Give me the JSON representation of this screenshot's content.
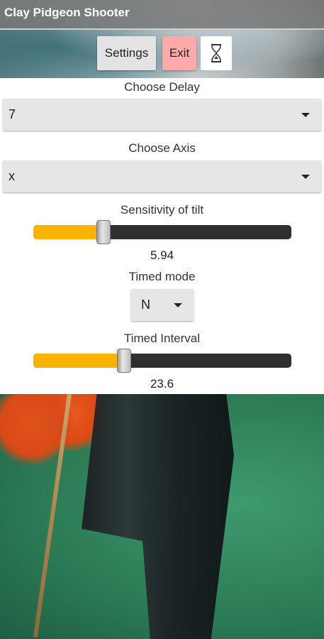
{
  "app": {
    "title": "Clay Pidgeon Shooter"
  },
  "toolbar": {
    "settings_label": "Settings",
    "exit_label": "Exit",
    "timer_icon": "hourglass-icon",
    "timer_glyph": "⌛",
    "colors": {
      "exit_bg": "#ffaaaa",
      "settings_bg": "#e3e3e3"
    }
  },
  "form": {
    "delay": {
      "label": "Choose Delay",
      "value": "7"
    },
    "axis": {
      "label": "Choose Axis",
      "value": "x"
    },
    "sensitivity": {
      "label": "Sensitivity of tilt",
      "value": "5.94",
      "fraction": 0.27
    },
    "timed_mode": {
      "label": "Timed mode",
      "value": "N"
    },
    "timed_interval": {
      "label": "Timed Interval",
      "value": "23.6",
      "fraction": 0.35
    }
  },
  "colors": {
    "accent": "#f8b400",
    "track": "#2f2f2f"
  }
}
